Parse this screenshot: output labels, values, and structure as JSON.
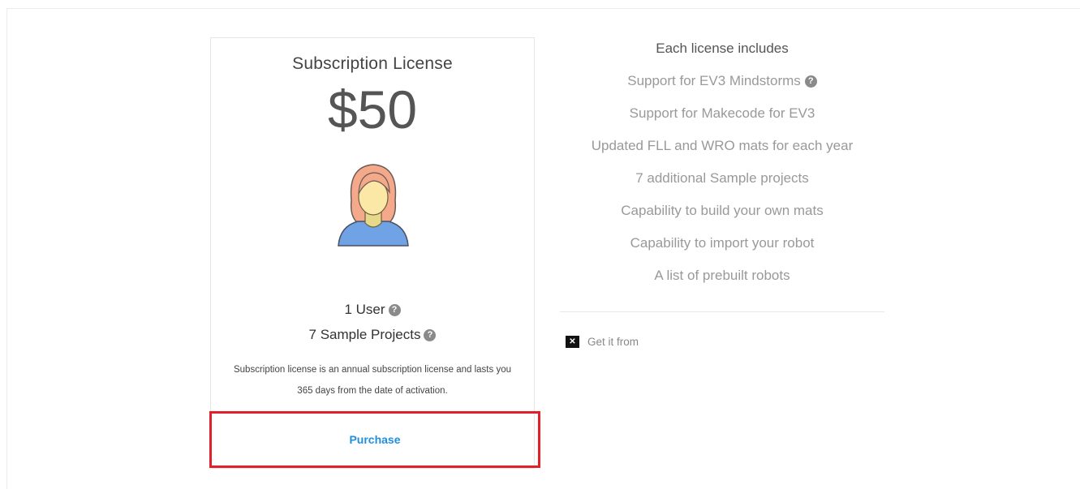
{
  "card": {
    "title": "Subscription License",
    "price": "$50",
    "users": "1 User",
    "sample_projects": "7 Sample Projects",
    "description": "Subscription license is an annual subscription license and lasts you 365 days from the date of activation.",
    "purchase_label": "Purchase"
  },
  "features": {
    "heading": "Each license includes",
    "items": [
      {
        "label": "Support for EV3 Mindstorms",
        "has_help": true
      },
      {
        "label": "Support for Makecode for EV3",
        "has_help": false
      },
      {
        "label": "Updated FLL and WRO mats for each year",
        "has_help": false
      },
      {
        "label": "7 additional Sample projects",
        "has_help": false
      },
      {
        "label": "Capability to build your own mats",
        "has_help": false
      },
      {
        "label": "Capability to import your robot",
        "has_help": false
      },
      {
        "label": "A list of prebuilt robots",
        "has_help": false
      }
    ]
  },
  "get_it": {
    "label": "Get it from"
  },
  "colors": {
    "accent_link": "#1f8fe0",
    "highlight_border": "#e0202a",
    "muted_text": "#999999"
  },
  "icons": {
    "help": "question-circle-icon",
    "avatar": "user-avatar-icon",
    "broken_image": "broken-image-icon"
  }
}
